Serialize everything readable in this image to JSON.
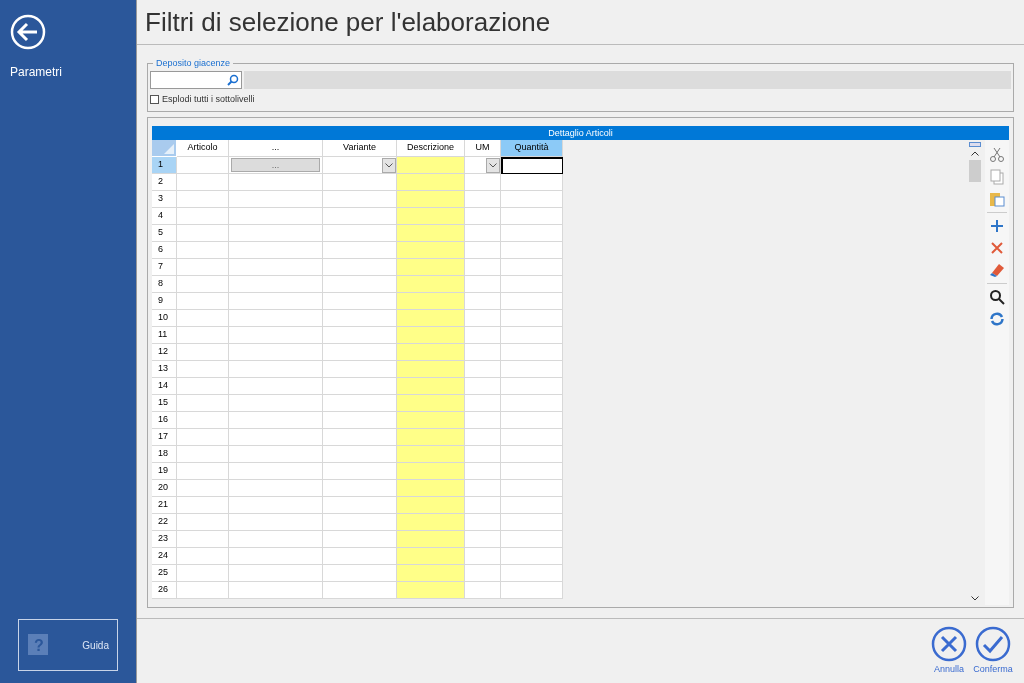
{
  "sidebar": {
    "label": "Parametri",
    "help": "Guida",
    "help_icon": "?"
  },
  "title": "Filtri di selezione per l'elaborazione",
  "deposit": {
    "legend": "Deposito giacenze",
    "explode": {
      "label": "Esplodi tutti i sottolivelli",
      "checked": false
    }
  },
  "grid": {
    "title": "Dettaglio Articoli",
    "columns": [
      {
        "label": "Articolo",
        "kind": "text",
        "selected": false
      },
      {
        "label": "...",
        "kind": "button",
        "selected": false,
        "cell_text": "..."
      },
      {
        "label": "Variante",
        "kind": "dropdown",
        "selected": false
      },
      {
        "label": "Descrizione",
        "kind": "readonly",
        "selected": false
      },
      {
        "label": "UM",
        "kind": "dropdown",
        "selected": false
      },
      {
        "label": "Quantità",
        "kind": "text",
        "selected": true
      }
    ],
    "rows": [
      {
        "number": "1",
        "selected": true
      },
      {
        "number": "2",
        "selected": false
      },
      {
        "number": "3",
        "selected": false
      },
      {
        "number": "4",
        "selected": false
      },
      {
        "number": "5",
        "selected": false
      },
      {
        "number": "6",
        "selected": false
      },
      {
        "number": "7",
        "selected": false
      },
      {
        "number": "8",
        "selected": false
      },
      {
        "number": "9",
        "selected": false
      },
      {
        "number": "10",
        "selected": false
      },
      {
        "number": "11",
        "selected": false
      },
      {
        "number": "12",
        "selected": false
      },
      {
        "number": "13",
        "selected": false
      },
      {
        "number": "14",
        "selected": false
      },
      {
        "number": "15",
        "selected": false
      },
      {
        "number": "16",
        "selected": false
      },
      {
        "number": "17",
        "selected": false
      },
      {
        "number": "18",
        "selected": false
      },
      {
        "number": "19",
        "selected": false
      },
      {
        "number": "20",
        "selected": false
      },
      {
        "number": "21",
        "selected": false
      },
      {
        "number": "22",
        "selected": false
      },
      {
        "number": "23",
        "selected": false
      },
      {
        "number": "24",
        "selected": false
      },
      {
        "number": "25",
        "selected": false
      },
      {
        "number": "26",
        "selected": false
      }
    ]
  },
  "buttons": [
    {
      "label": "Annulla",
      "kind": "cancel"
    },
    {
      "label": "Conferma",
      "kind": "confirm"
    }
  ]
}
